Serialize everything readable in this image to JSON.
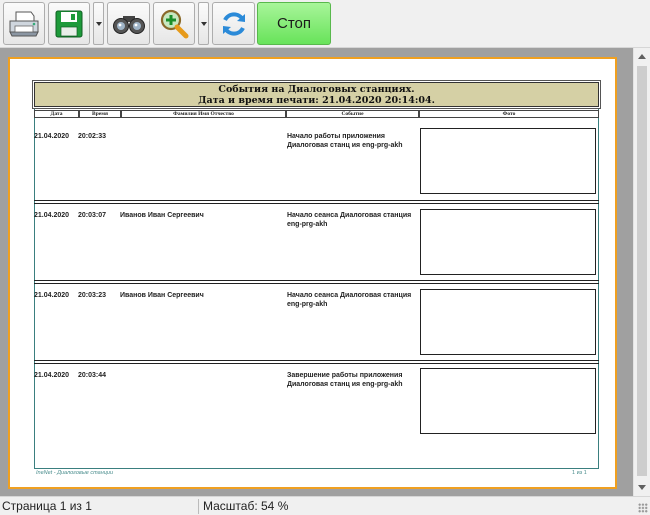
{
  "toolbar": {
    "buttons": [
      {
        "icon": "printer-icon"
      },
      {
        "icon": "save-icon"
      },
      {
        "icon": "binoculars-icon"
      },
      {
        "icon": "zoom-in-icon"
      },
      {
        "icon": "refresh-icon"
      }
    ],
    "stop_label": "Стоп"
  },
  "report": {
    "title_line1": "События на Диалоговых станциях.",
    "title_line2": "Дата и время печати: 21.04.2020 20:14:04.",
    "columns": {
      "date": "Дата",
      "time": "Время",
      "name": "Фамилия Имя Отчество",
      "event": "Событие",
      "photo": "Фото"
    },
    "records": [
      {
        "date": "21.04.2020",
        "time": "20:02:33",
        "name": "",
        "event_line1": "Начало работы приложения",
        "event_line2": "Диалоговая станц ия  eng-prg-akh"
      },
      {
        "date": "21.04.2020",
        "time": "20:03:07",
        "name": "Иванов Иван Сергеевич",
        "event_line1": "Начало сеанса Диалоговая станция",
        "event_line2": "eng-prg-akh"
      },
      {
        "date": "21.04.2020",
        "time": "20:03:23",
        "name": "Иванов Иван Сергеевич",
        "event_line1": "Начало сеанса Диалоговая станция",
        "event_line2": "eng-prg-akh"
      },
      {
        "date": "21.04.2020",
        "time": "20:03:44",
        "name": "",
        "event_line1": "Завершение работы приложения",
        "event_line2": "Диалоговая станц ия  eng-prg-akh"
      }
    ],
    "footer_left": "IneNet - Диалоговые станции",
    "footer_right": "1 из 1"
  },
  "status": {
    "page": "Страница 1 из 1",
    "zoom": "Масштаб: 54 %"
  },
  "colors": {
    "stop_button": "#68e35a",
    "header_fill": "#d5d0a5",
    "page_border": "#f0a020",
    "accent_teal": "#3a7f7f"
  }
}
